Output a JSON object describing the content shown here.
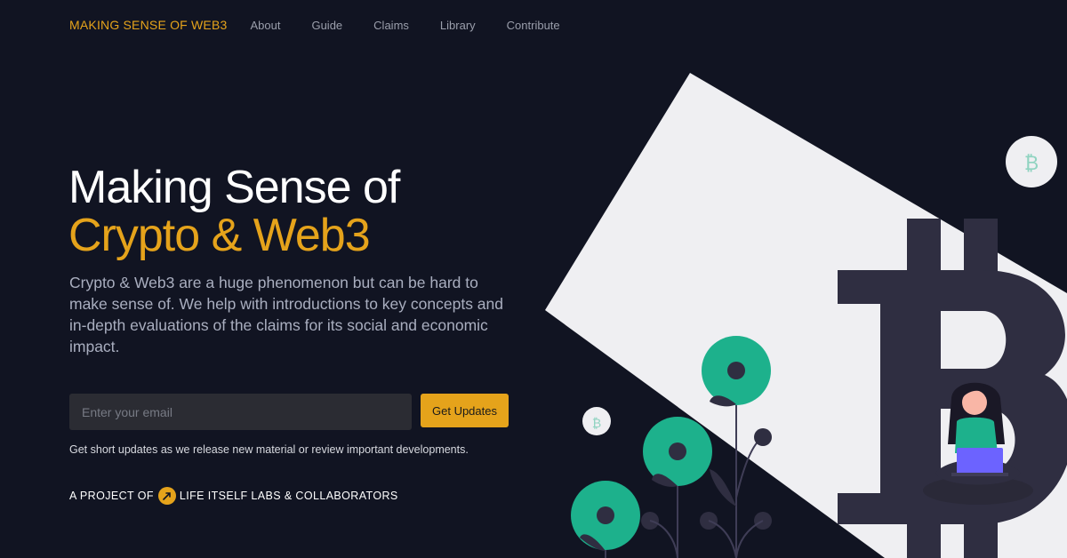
{
  "nav": {
    "brand": "MAKING SENSE OF WEB3",
    "links": [
      "About",
      "Guide",
      "Claims",
      "Library",
      "Contribute"
    ]
  },
  "hero": {
    "title_line1": "Making Sense of",
    "title_line2": "Crypto & Web3",
    "description": "Crypto & Web3 are a huge phenomenon but can be hard to make sense of. We help with introductions to key concepts and in-depth evaluations of the claims for its social and economic impact."
  },
  "signup": {
    "email_placeholder": "Enter your email",
    "email_value": "",
    "button_label": "Get Updates",
    "note": "Get short updates as we release new material or review important developments."
  },
  "footer": {
    "project_prefix": "A PROJECT OF",
    "project_name": "LIFE ITSELF LABS & COLLABORATORS"
  },
  "illustration": {
    "coin_symbol": "₿"
  },
  "colors": {
    "background": "#111422",
    "accent": "#e5a31b",
    "plant_green": "#1db18c",
    "bitcoin_dark": "#2f2e41",
    "sheet": "#efeff2"
  }
}
